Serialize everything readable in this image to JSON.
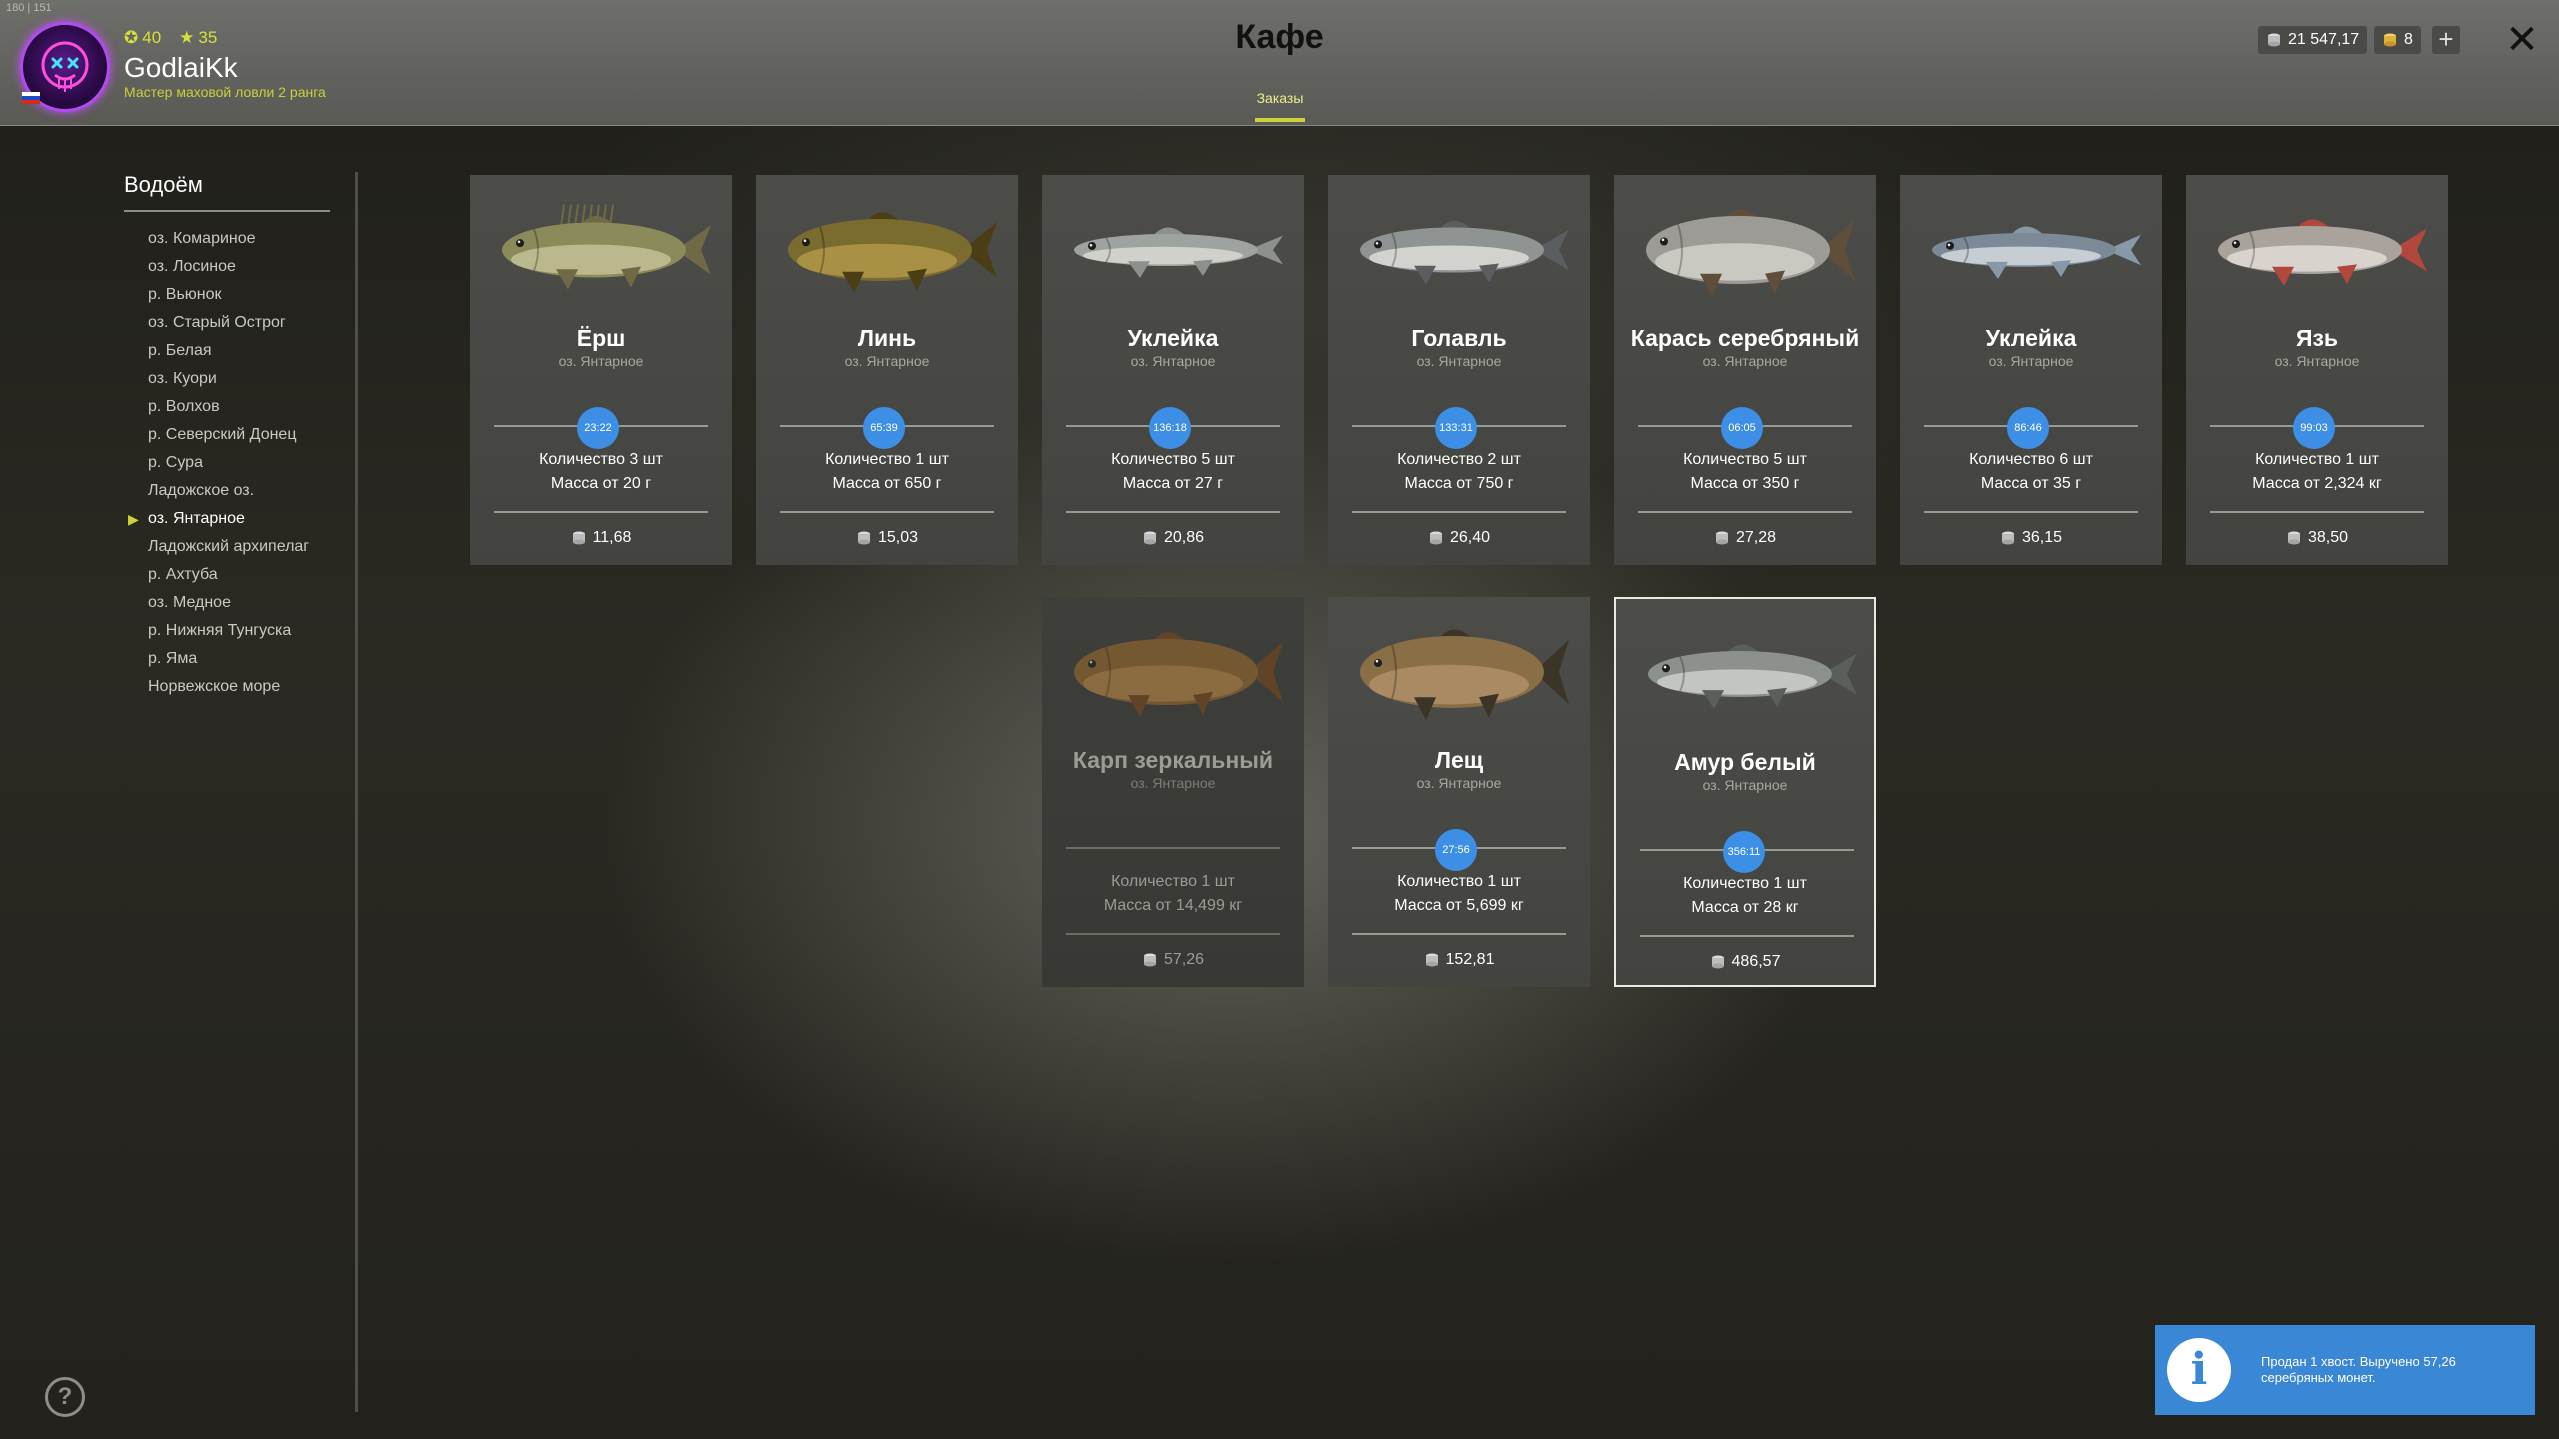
{
  "fps": "180 | 151",
  "player": {
    "level": "40",
    "stars": "35",
    "name": "GodlaiKk",
    "rank": "Мастер маховой ловли 2 ранга"
  },
  "header": {
    "title": "Кафе",
    "tab": "Заказы",
    "silver": "21 547,17",
    "gold": "8",
    "plus": "+",
    "close": "✕"
  },
  "sidebar": {
    "title": "Водоём",
    "items": [
      "оз. Комариное",
      "оз. Лосиное",
      "р. Вьюнок",
      "оз. Старый Острог",
      "р. Белая",
      "оз. Куори",
      "р. Волхов",
      "р. Северский Донец",
      "р. Сура",
      "Ладожское оз.",
      "оз. Янтарное",
      "Ладожский архипелаг",
      "р. Ахтуба",
      "оз. Медное",
      "р. Нижняя Тунгуска",
      "р. Яма",
      "Норвежское море"
    ],
    "active_index": 10
  },
  "orders": [
    {
      "name": "Ёрш",
      "location": "оз. Янтарное",
      "timer": "23:22",
      "quantity": "Количество 3 шт",
      "mass": "Масса от 20 г",
      "price": "11,68",
      "fish": "ruffe"
    },
    {
      "name": "Линь",
      "location": "оз. Янтарное",
      "timer": "65:39",
      "quantity": "Количество 1 шт",
      "mass": "Масса от 650 г",
      "price": "15,03",
      "fish": "tench"
    },
    {
      "name": "Уклейка",
      "location": "оз. Янтарное",
      "timer": "136:18",
      "quantity": "Количество 5 шт",
      "mass": "Масса от 27 г",
      "price": "20,86",
      "fish": "bleak"
    },
    {
      "name": "Голавль",
      "location": "оз. Янтарное",
      "timer": "133:31",
      "quantity": "Количество 2 шт",
      "mass": "Масса от 750 г",
      "price": "26,40",
      "fish": "chub"
    },
    {
      "name": "Карась серебряный",
      "location": "оз. Янтарное",
      "timer": "06:05",
      "quantity": "Количество 5 шт",
      "mass": "Масса от 350 г",
      "price": "27,28",
      "fish": "carp-silver"
    },
    {
      "name": "Уклейка",
      "location": "оз. Янтарное",
      "timer": "86:46",
      "quantity": "Количество 6 шт",
      "mass": "Масса от 35 г",
      "price": "36,15",
      "fish": "bleak2"
    },
    {
      "name": "Язь",
      "location": "оз. Янтарное",
      "timer": "99:03",
      "quantity": "Количество 1 шт",
      "mass": "Масса от 2,324 кг",
      "price": "38,50",
      "fish": "ide"
    },
    {
      "name": "Карп зеркальный",
      "location": "оз. Янтарное",
      "timer": "",
      "quantity": "Количество 1 шт",
      "mass": "Масса от 14,499 кг",
      "price": "57,26",
      "fish": "mirror-carp",
      "state": "completed"
    },
    {
      "name": "Лещ",
      "location": "оз. Янтарное",
      "timer": "27:56",
      "quantity": "Количество 1 шт",
      "mass": "Масса от 5,699 кг",
      "price": "152,81",
      "fish": "bream"
    },
    {
      "name": "Амур белый",
      "location": "оз. Янтарное",
      "timer": "356:11",
      "quantity": "Количество 1 шт",
      "mass": "Масса от 28 кг",
      "price": "486,57",
      "fish": "grass-carp",
      "state": "selected"
    }
  ],
  "notification": {
    "icon": "info-icon",
    "message": "Продан 1 хвост. Выручено 57,26 серебряных монет."
  },
  "help": "?",
  "colors": {
    "accent": "#c8d43a",
    "timer": "#3d8fe6",
    "notification": "#3a87d6"
  }
}
